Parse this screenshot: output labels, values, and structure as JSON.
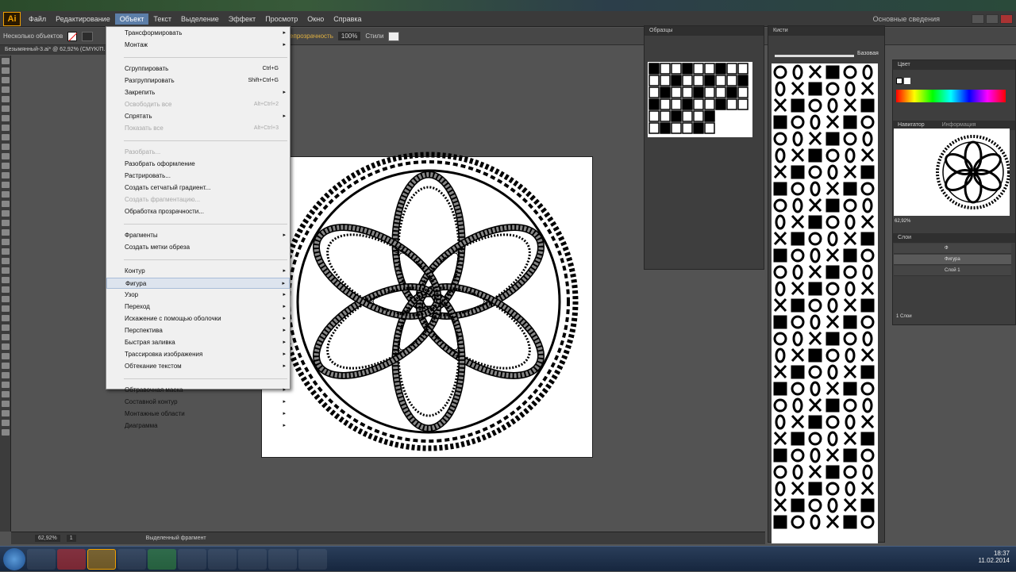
{
  "app": {
    "logo": "Ai",
    "workspace": "Основные сведения"
  },
  "menubar": {
    "items": [
      "Файл",
      "Редактирование",
      "Объект",
      "Текст",
      "Выделение",
      "Эффект",
      "Просмотр",
      "Окно",
      "Справка"
    ],
    "active_index": 2
  },
  "controlbar": {
    "label": "Несколько объектов",
    "opacity_label": "Непрозрачность",
    "opacity_value": "100%",
    "styles_label": "Стили"
  },
  "document": {
    "tab_title": "Безымянный-3.ai* @ 62,92% (CMYK/П..."
  },
  "object_menu": {
    "items": [
      {
        "label": "Трансформировать",
        "arrow": true
      },
      {
        "label": "Монтаж",
        "arrow": true
      },
      {
        "sep": true
      },
      {
        "label": "Сгруппировать",
        "shortcut": "Ctrl+G"
      },
      {
        "label": "Разгруппировать",
        "shortcut": "Shift+Ctrl+G"
      },
      {
        "label": "Закрепить",
        "arrow": true
      },
      {
        "label": "Освободить все",
        "shortcut": "Alt+Ctrl+2",
        "disabled": true
      },
      {
        "label": "Спрятать",
        "arrow": true
      },
      {
        "label": "Показать все",
        "shortcut": "Alt+Ctrl+3",
        "disabled": true
      },
      {
        "sep": true
      },
      {
        "label": "Разобрать...",
        "disabled": true
      },
      {
        "label": "Разобрать оформление"
      },
      {
        "label": "Растрировать..."
      },
      {
        "label": "Создать сетчатый градиент..."
      },
      {
        "label": "Создать фрагментацию...",
        "disabled": true
      },
      {
        "label": "Обработка прозрачности..."
      },
      {
        "sep": true
      },
      {
        "label": "Фрагменты",
        "arrow": true
      },
      {
        "label": "Создать метки обреза"
      },
      {
        "sep": true
      },
      {
        "label": "Контур",
        "arrow": true
      },
      {
        "label": "Фигура",
        "arrow": true,
        "highlight": true
      },
      {
        "label": "Узор",
        "arrow": true
      },
      {
        "label": "Переход",
        "arrow": true
      },
      {
        "label": "Искажение с помощью оболочки",
        "arrow": true
      },
      {
        "label": "Перспектива",
        "arrow": true
      },
      {
        "label": "Быстрая заливка",
        "arrow": true
      },
      {
        "label": "Трассировка изображения",
        "arrow": true
      },
      {
        "label": "Обтекание текстом",
        "arrow": true
      },
      {
        "sep": true
      },
      {
        "label": "Обтравочная маска",
        "arrow": true
      },
      {
        "label": "Составной контур",
        "arrow": true
      },
      {
        "label": "Монтажные области",
        "arrow": true
      },
      {
        "label": "Диаграмма",
        "arrow": true
      }
    ]
  },
  "panels": {
    "symbols": {
      "title": "Образцы"
    },
    "brushes": {
      "title": "Кисти",
      "basic_label": "Базовая"
    },
    "color": {
      "title": "Цвет"
    },
    "navigator": {
      "tab1": "Навигатор",
      "tab2": "Информация",
      "zoom": "62,92%"
    },
    "layers": {
      "title": "Слои",
      "rows": [
        "Ф",
        "Фигура",
        "Слой 1"
      ],
      "footer": "1 Слои"
    }
  },
  "statusbar": {
    "zoom": "62,92%",
    "page": "1",
    "tool": "Выделенный фрагмент"
  },
  "taskbar": {
    "time": "18:37",
    "date": "11.02.2014"
  },
  "colors": {
    "accent": "#5c7ea8",
    "menu_bg": "#f0f0f0",
    "ui_dark": "#535353"
  }
}
